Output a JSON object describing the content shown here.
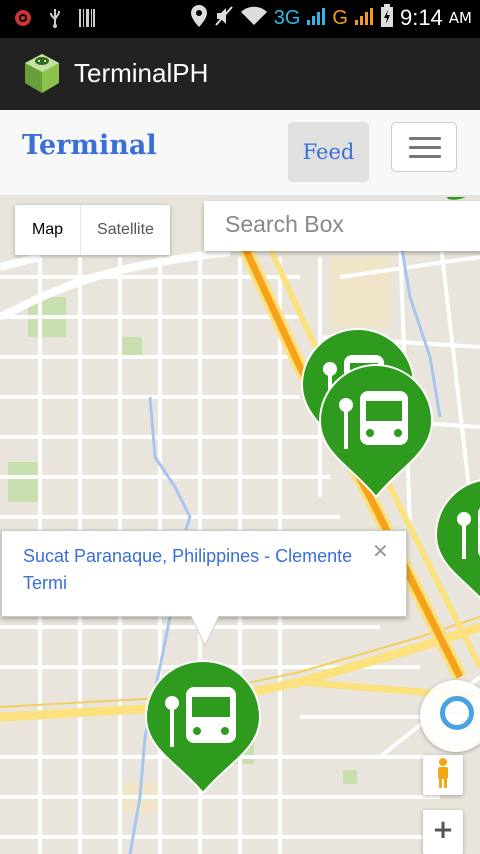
{
  "status_bar": {
    "network_3g": "3G",
    "network_g": "G",
    "time": "9:14",
    "ampm": "AM"
  },
  "action_bar": {
    "title": "TerminalPH",
    "icon": "android-icon"
  },
  "navbar": {
    "brand": "Terminal",
    "feed_label": "Feed",
    "toggle_icon": "hamburger-menu-icon"
  },
  "map": {
    "map_type_options": [
      "Map",
      "Satellite"
    ],
    "selected_map_type": "Map",
    "search_placeholder": "Search Box",
    "info_window": {
      "text": "Sucat Paranaque, Philippines - Clemente Termi",
      "close_glyph": "✕"
    },
    "zoom_in_label": "+",
    "marker_icon": "bus-stop-icon",
    "marker_color": "#2e9b1f"
  },
  "colors": {
    "brand_blue": "#3a6fd8",
    "marker_green": "#2e9b1f",
    "highway_orange": "#f7a21b",
    "road_yellow": "#fbe27e"
  }
}
